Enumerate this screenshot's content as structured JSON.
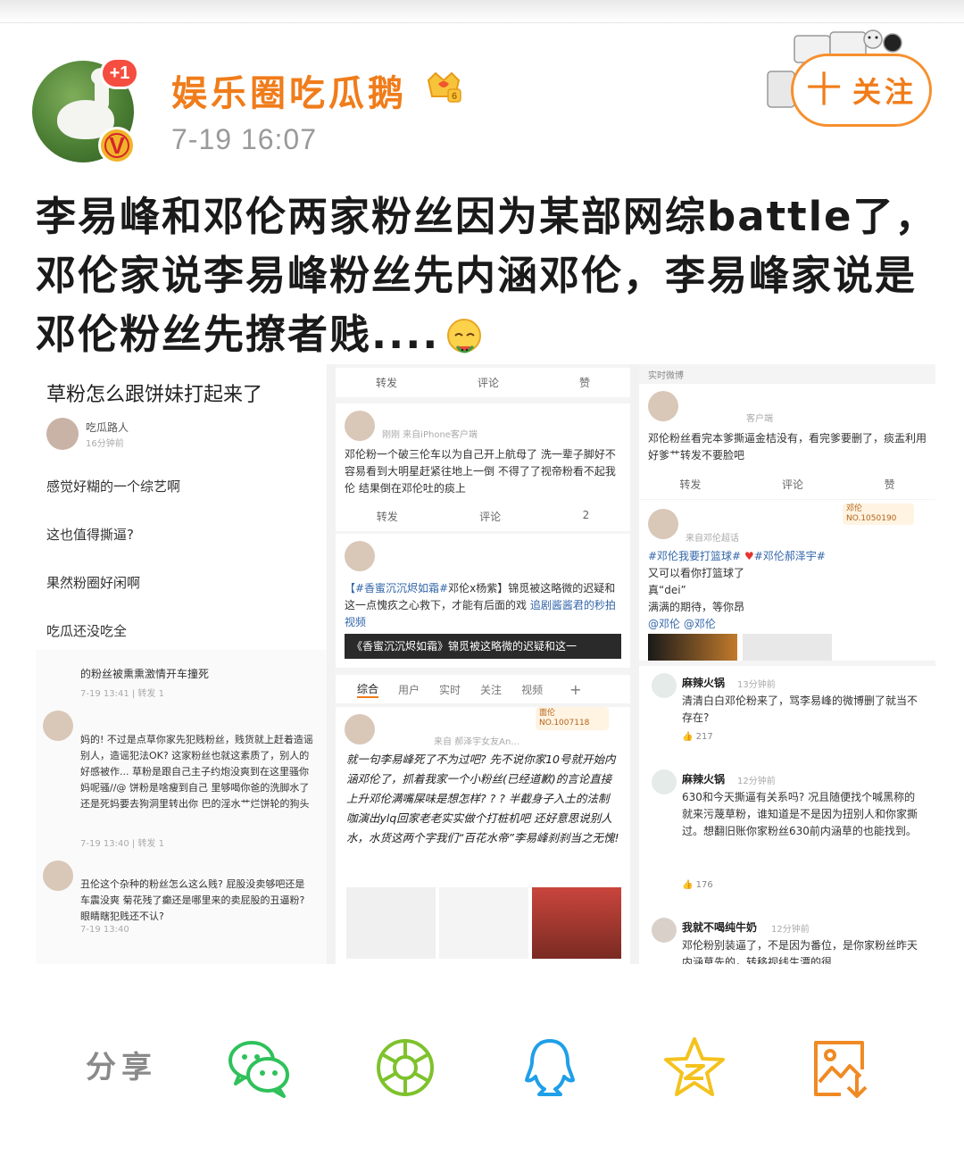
{
  "header": {
    "user_name": "娱乐圈吃瓜鹅",
    "post_time": "7-19 16:07",
    "avatar_badge": "+1",
    "verified_badge": "V",
    "follow_plus": "十",
    "follow_label": "关注"
  },
  "post": {
    "text": "李易峰和邓伦两家粉丝因为某部网综battle了，邓伦家说李易峰粉丝先内涵邓伦，李易峰家说是邓伦粉丝先撩者贱...."
  },
  "collage": {
    "panel1": {
      "title": "草粉怎么跟饼妹打起来了",
      "author": "吃瓜路人",
      "author_time": "16分钟前",
      "lines": [
        "感觉好糊的一个综艺啊",
        "这也值得撕逼?",
        "果然粉圈好闲啊",
        "吃瓜还没吃全"
      ],
      "c1_text": "的粉丝被熏熏激情开车撞死",
      "c1_meta": "7-19 13:41 | 转发 1",
      "c2_text": "妈的! 不过是点草你家先犯贱粉丝，贱货就上赶着造谣别人，造谣犯法OK? 这家粉丝也就这素质了，别人的好感被作... 草粉是跟自己主子约炮没爽到在这里骚你妈呢骚//@ 饼粉是啥瘦到自己 里够喝你爸的洗脚水了还是死妈要去狗洞里转出你 巴的淫水艹烂饼轮的狗头",
      "c2_meta": "7-19 13:40 | 转发 1",
      "c3_text": "丑伦这个杂种的粉丝怎么这么贱? 屁股没卖够吧还是车震没爽 菊花残了癫还是哪里来的卖屁股的丑逼粉? 眼睛瞎犯贱还不认?",
      "c3_meta": "7-19 13:40"
    },
    "panel2": {
      "act_repost": "转发",
      "act_comment": "评论",
      "act_like": "赞",
      "like_count": "2",
      "post1_src": "刚刚  来自iPhone客户端",
      "post1_text": "邓伦粉一个破三伦车以为自己开上航母了 洗一辈子脚好不容易看到大明星赶紧往地上一倒 不得了了视帝粉看不起我伦 结果倒在邓伦吐的痰上",
      "post2_text_a": "【#香蜜沉沉烬如霜#",
      "post2_text_b": "邓伦x杨紫】锦觅被这略微的迟疑和这一点愧疚之心救下，才能有后面的戏 ",
      "post2_link": "追剧酱酱君的秒拍视频",
      "video_caption": "《香蜜沉沉烬如霜》锦觅被这略微的迟疑和这一",
      "tabs": [
        "综合",
        "用户",
        "实时",
        "关注",
        "视频"
      ],
      "tab_plus": "+",
      "badge_label": "面伦",
      "badge_no": "NO.1007118",
      "post3_src": "来自 郝泽宇女友An...",
      "post3_text": "就一句李易峰死了不为过吧? 先不说你家10号就开始内涵邓伦了，抓着我家一个小粉丝(已经道歉)的言论直接上升邓伦满嘴屎味是想怎样? ? ? 半截身子入土的法制咖演出ylq回家老老实实做个打桩机吧 还好意思说别人水，水货这两个字我们“百花水帝”李易峰刹刹当之无愧!"
    },
    "panel3": {
      "header": "实时微博",
      "post1_src": "客户端",
      "post1_text": "邓伦粉丝看完本爹撕逼金桔没有，看完爹要删了，痰盂利用好爹艹转发不要脸吧",
      "act_repost": "转发",
      "act_comment": "评论",
      "act_like": "赞",
      "badge_label": "邓伦",
      "badge_no": "NO.1050190",
      "post2_src": "来自邓伦超话",
      "post2_tag1": "#邓伦我要打篮球#",
      "post2_tag2": "#邓伦郝泽宇#",
      "post2_l1": "又可以看你打篮球了",
      "post2_l2": "真“dei”",
      "post2_l3": "满满的期待，等你昂",
      "post2_l4": "@邓伦 @邓伦",
      "c1_name": "麻辣火锅",
      "c1_time": "13分钟前",
      "c1_text": "清清白白邓伦粉来了，骂李易峰的微博删了就当不存在?",
      "c1_likes": "217",
      "c2_name": "麻辣火锅",
      "c2_time": "12分钟前",
      "c2_text": "630和今天撕逼有关系吗? 况且随便找个喊黑称的就来污蔑草粉，谁知道是不是因为扭别人和你家撕过。想翻旧账你家粉丝630前内涵草的也能找到。",
      "c2_likes": "176",
      "c3_name": "我就不喝纯牛奶",
      "c3_time": "12分钟前",
      "c3_text": "邓伦粉别装逼了，不是因为番位，是你家粉丝昨天内涵草先的，转移视线生潭的很"
    }
  },
  "share": {
    "label": "分享"
  },
  "colors": {
    "accent_orange": "#f07c1a",
    "wechat_green": "#2fc15b",
    "moments_green": "#7ec22c",
    "qq_blue": "#1f9fe8",
    "qzone_yellow": "#f4c21d",
    "save_orange": "#f08a24"
  },
  "icons": [
    "wechat-icon",
    "moments-icon",
    "qq-icon",
    "qzone-icon",
    "save-image-icon"
  ]
}
